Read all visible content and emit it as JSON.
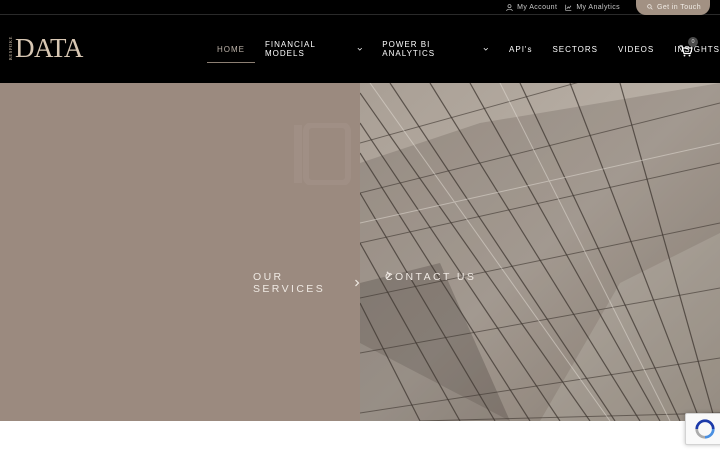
{
  "topbar": {
    "my_account": "My Account",
    "my_analytics": "My Analytics",
    "get_in_touch": "Get in Touch",
    "icons": [
      "user-icon",
      "chart-icon",
      "search-icon"
    ]
  },
  "logo": {
    "small_text": "BESPOKE",
    "main_text": "DATA"
  },
  "nav": {
    "items": [
      {
        "label": "HOME",
        "active": true,
        "dropdown": false
      },
      {
        "label": "FINANCIAL MODELS",
        "active": false,
        "dropdown": true
      },
      {
        "label": "POWER BI ANALYTICS",
        "active": false,
        "dropdown": true
      },
      {
        "label": "API's",
        "active": false,
        "dropdown": false
      },
      {
        "label": "SECTORS",
        "active": false,
        "dropdown": false
      },
      {
        "label": "VIDEOS",
        "active": false,
        "dropdown": false
      },
      {
        "label": "INSIGHTS",
        "active": false,
        "dropdown": false
      }
    ],
    "cart_count": "0"
  },
  "hero": {
    "services_label": "OUR SERVICES",
    "contact_label": "CONTACT US"
  },
  "colors": {
    "header_bg": "#000000",
    "accent": "#a29183",
    "hero_left": "#9b8a7f",
    "hero_right": "#8c8278"
  }
}
